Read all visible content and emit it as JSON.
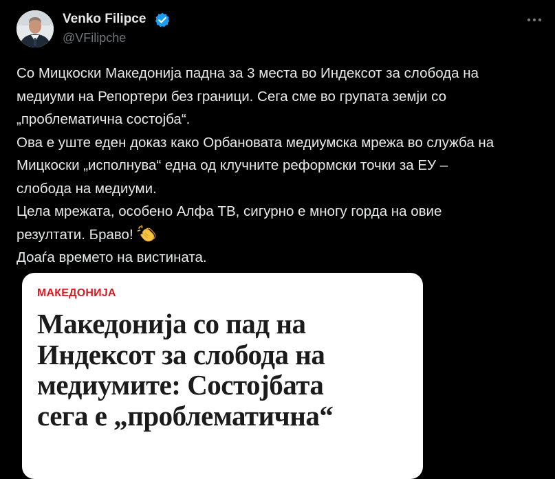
{
  "tweet": {
    "author": {
      "name": "Venko Filipce",
      "handle": "@VFilipche",
      "verified": true,
      "verified_color": "#1d9bf0"
    },
    "more_icon": "more-horizontal-icon",
    "text_lines": [
      "Со Мицкоски Македонија падна за 3 места во Индексот за слобода на",
      "медиуми на Репортери без граници. Сега сме во групата земји со",
      "„проблематична состојба“.",
      "Ова е уште еден доказ како Орбановата медиумска мрежа во служба на",
      "Мицкоски „исполнува“ една од клучните реформски точки за ЕУ –",
      "слобода на медиуми.",
      "Цела мрежата, особено Алфа ТВ, сигурно е многу горда на овие",
      "резултати. Браво!",
      "Доаѓа времето на вистината."
    ],
    "emoji": "clapping-hands-icon"
  },
  "media": {
    "category": "МАКЕДОНИЈА",
    "category_color": "#d81a21",
    "headline_lines": [
      "Македонија со пад на",
      "Индексот за слобода на",
      "медиумите: Состојбата",
      "сега е „проблематична“"
    ]
  }
}
